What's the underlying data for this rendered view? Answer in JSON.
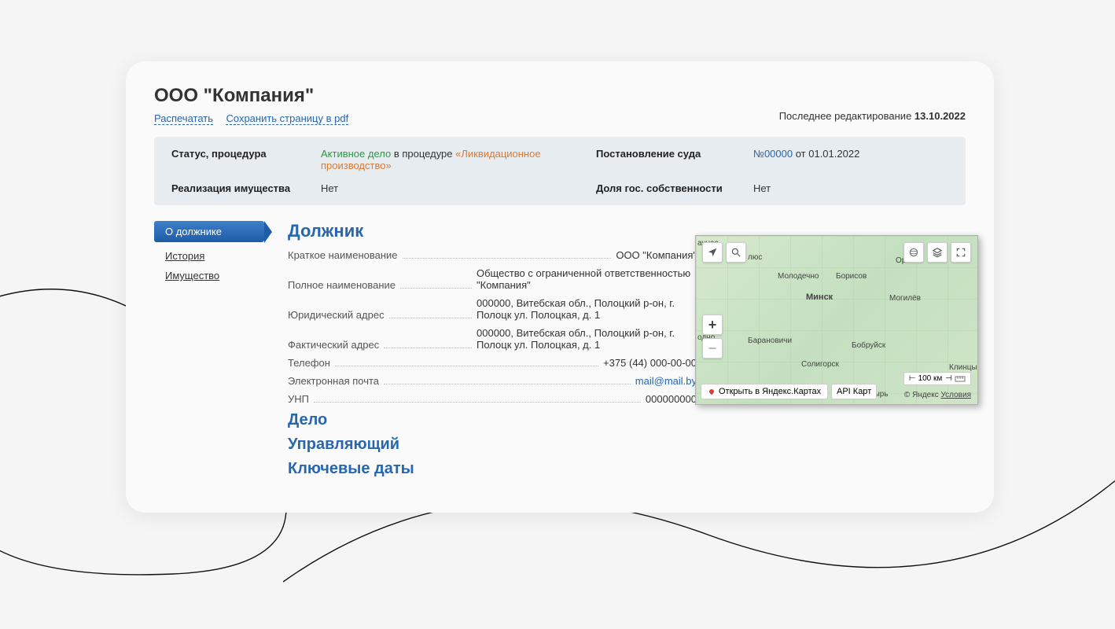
{
  "header": {
    "title": "ООО \"Компания\"",
    "print": "Распечатать",
    "savePdf": "Сохранить страницу в pdf",
    "lastEditLabel": "Последнее редактирование ",
    "lastEditDate": "13.10.2022"
  },
  "status": {
    "statusLabel": "Статус, процедура",
    "activeCase": "Активное дело",
    "inProcedure": " в процедуре ",
    "procedure": "«Ликвидационное производство»",
    "realizationLabel": "Реализация имущества",
    "realizationValue": "Нет",
    "courtLabel": "Постановление суда",
    "courtNumber": "№00000",
    "courtDate": " от 01.01.2022",
    "shareLabel": "Доля гос. собственности",
    "shareValue": "Нет"
  },
  "sidebar": {
    "about": "О должнике",
    "history": "История",
    "property": "Имущество"
  },
  "debtor": {
    "title": "Должник",
    "rows": {
      "shortNameLabel": "Краткое наименование",
      "shortNameValue": "ООО \"Компания\"",
      "fullNameLabel": "Полное наименование",
      "fullNameValue": "Общество с ограниченной ответственностью \"Компания\"",
      "legalAddressLabel": "Юридический адрес",
      "legalAddressValue": "000000, Витебская обл., Полоцкий р-он, г. Полоцк ул. Полоцкая, д. 1",
      "actualAddressLabel": "Фактический адрес",
      "actualAddressValue": "000000, Витебская обл., Полоцкий р-он, г. Полоцк ул. Полоцкая, д. 1",
      "phoneLabel": "Телефон",
      "phoneValue": "+375 (44) 000-00-00",
      "emailLabel": "Электронная почта",
      "emailValue": "mail@mail.by",
      "unpLabel": "УНП",
      "unpValue": "000000000"
    }
  },
  "sections": {
    "case": "Дело",
    "manager": "Управляющий",
    "keyDates": "Ключевые даты"
  },
  "map": {
    "cities": {
      "minsk": "Минск",
      "molodechno": "Молодечно",
      "borisov": "Борисов",
      "mogilev": "Могилёв",
      "baranovichi": "Барановичи",
      "bobruisk": "Бобруйск",
      "soligorsk": "Солигорск",
      "klintsy": "Клинцы",
      "orsha": "Орша",
      "kaunas": "аунас",
      "grodno": "одно",
      "zhlobin": "зырь",
      "olyus": "люс"
    },
    "openInYandex": "Открыть в Яндекс.Картах",
    "apiLabel": "API Карт",
    "copyright": "© Яндекс ",
    "terms": "Условия",
    "scale": "100 км"
  }
}
